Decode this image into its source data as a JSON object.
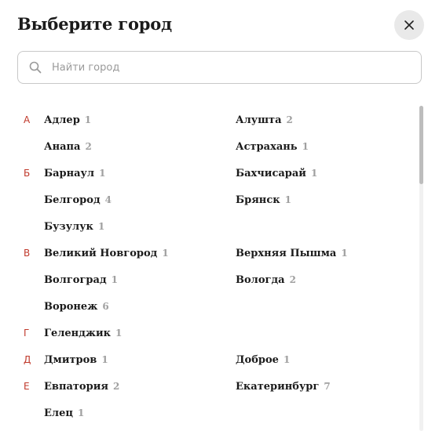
{
  "modal": {
    "title": "Выберите город",
    "close_icon": "close-icon"
  },
  "search": {
    "placeholder": "Найти город",
    "value": "",
    "icon": "search-icon"
  },
  "colors": {
    "letter": "#c0392b",
    "count": "#a0a0a0",
    "text": "#1b1b1b",
    "close_bg": "#e9e9e9"
  },
  "rows": [
    {
      "letter": "А",
      "left": {
        "name": "Адлер",
        "count": "1"
      },
      "right": {
        "name": "Алушта",
        "count": "2"
      }
    },
    {
      "letter": "",
      "left": {
        "name": "Анапа",
        "count": "2"
      },
      "right": {
        "name": "Астрахань",
        "count": "1"
      }
    },
    {
      "letter": "Б",
      "left": {
        "name": "Барнаул",
        "count": "1"
      },
      "right": {
        "name": "Бахчисарай",
        "count": "1"
      }
    },
    {
      "letter": "",
      "left": {
        "name": "Белгород",
        "count": "4"
      },
      "right": {
        "name": "Брянск",
        "count": "1"
      }
    },
    {
      "letter": "",
      "left": {
        "name": "Бузулук",
        "count": "1"
      },
      "right": null
    },
    {
      "letter": "В",
      "left": {
        "name": "Великий Новгород",
        "count": "1"
      },
      "right": {
        "name": "Верхняя Пышма",
        "count": "1"
      }
    },
    {
      "letter": "",
      "left": {
        "name": "Волгоград",
        "count": "1"
      },
      "right": {
        "name": "Вологда",
        "count": "2"
      }
    },
    {
      "letter": "",
      "left": {
        "name": "Воронеж",
        "count": "6"
      },
      "right": null
    },
    {
      "letter": "Г",
      "left": {
        "name": "Геленджик",
        "count": "1"
      },
      "right": null
    },
    {
      "letter": "Д",
      "left": {
        "name": "Дмитров",
        "count": "1"
      },
      "right": {
        "name": "Доброе",
        "count": "1"
      }
    },
    {
      "letter": "Е",
      "left": {
        "name": "Евпатория",
        "count": "2"
      },
      "right": {
        "name": "Екатеринбург",
        "count": "7"
      }
    },
    {
      "letter": "",
      "left": {
        "name": "Елец",
        "count": "1"
      },
      "right": null
    }
  ]
}
